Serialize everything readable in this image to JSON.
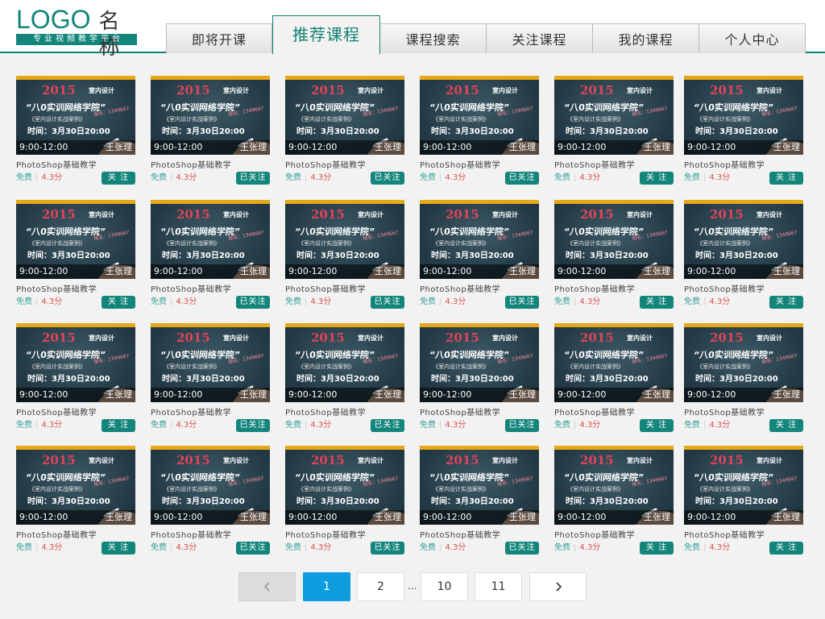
{
  "header": {
    "logo_text": "LOGO",
    "logo_name": "名称",
    "logo_sub": "专业视频教学平台",
    "brand_color": "#13857a"
  },
  "nav": {
    "tabs": [
      {
        "label": "即将开课",
        "active": false
      },
      {
        "label": "推荐课程",
        "active": true
      },
      {
        "label": "课程搜索",
        "active": false
      },
      {
        "label": "关注课程",
        "active": false
      },
      {
        "label": "我的课程",
        "active": false
      },
      {
        "label": "个人中心",
        "active": false
      }
    ]
  },
  "thumbnail_text": {
    "year": "2015",
    "tag": "室内设计",
    "line1": "“八0实训网络学院”",
    "line2": "《室内设计实战案例》",
    "line3": "时间：3月30日20:00",
    "line4": "报名：1349667"
  },
  "courses": {
    "rows": [
      [
        {
          "time": "9:00-12:00",
          "teacher": "王张理",
          "title": "PhotoShop基础教学",
          "price": "免费",
          "score": "4.3分",
          "follow": "关 注"
        },
        {
          "time": "9:00-12:00",
          "teacher": "王张理",
          "title": "PhotoShop基础教学",
          "price": "免费",
          "score": "4.3分",
          "follow": "已关注"
        },
        {
          "time": "9:00-12:00",
          "teacher": "王张理",
          "title": "PhotoShop基础教学",
          "price": "免费",
          "score": "4.3分",
          "follow": "已关注"
        },
        {
          "time": "9:00-12:00",
          "teacher": "王张理",
          "title": "PhotoShop基础教学",
          "price": "免费",
          "score": "4.3分",
          "follow": "已关注"
        },
        {
          "time": "9:00-12:00",
          "teacher": "王张理",
          "title": "PhotoShop基础教学",
          "price": "免费",
          "score": "4.3分",
          "follow": "关 注"
        },
        {
          "time": "9:00-12:00",
          "teacher": "王张理",
          "title": "PhotoShop基础教学",
          "price": "免费",
          "score": "4.3分",
          "follow": "关 注"
        }
      ],
      [
        {
          "time": "9:00-12:00",
          "teacher": "王张理",
          "title": "PhotoShop基础教学",
          "price": "免费",
          "score": "4.3分",
          "follow": "关 注"
        },
        {
          "time": "9:00-12:00",
          "teacher": "王张理",
          "title": "PhotoShop基础教学",
          "price": "免费",
          "score": "4.3分",
          "follow": "已关注"
        },
        {
          "time": "9:00-12:00",
          "teacher": "王张理",
          "title": "PhotoShop基础教学",
          "price": "免费",
          "score": "4.3分",
          "follow": "已关注"
        },
        {
          "time": "9:00-12:00",
          "teacher": "王张理",
          "title": "PhotoShop基础教学",
          "price": "免费",
          "score": "4.3分",
          "follow": "已关注"
        },
        {
          "time": "9:00-12:00",
          "teacher": "王张理",
          "title": "PhotoShop基础教学",
          "price": "免费",
          "score": "4.3分",
          "follow": "关 注"
        },
        {
          "time": "9:00-12:00",
          "teacher": "王张理",
          "title": "PhotoShop基础教学",
          "price": "免费",
          "score": "4.3分",
          "follow": "关 注"
        }
      ],
      [
        {
          "time": "9:00-12:00",
          "teacher": "王张理",
          "title": "PhotoShop基础教学",
          "price": "免费",
          "score": "4.3分",
          "follow": "关 注"
        },
        {
          "time": "9:00-12:00",
          "teacher": "王张理",
          "title": "PhotoShop基础教学",
          "price": "免费",
          "score": "4.3分",
          "follow": "已关注"
        },
        {
          "time": "9:00-12:00",
          "teacher": "王张理",
          "title": "PhotoShop基础教学",
          "price": "免费",
          "score": "4.3分",
          "follow": "已关注"
        },
        {
          "time": "9:00-12:00",
          "teacher": "王张理",
          "title": "PhotoShop基础教学",
          "price": "免费",
          "score": "4.3分",
          "follow": "已关注"
        },
        {
          "time": "9:00-12:00",
          "teacher": "王张理",
          "title": "PhotoShop基础教学",
          "price": "免费",
          "score": "4.3分",
          "follow": "关 注"
        },
        {
          "time": "9:00-12:00",
          "teacher": "王张理",
          "title": "PhotoShop基础教学",
          "price": "免费",
          "score": "4.3分",
          "follow": "关 注"
        }
      ],
      [
        {
          "time": "9:00-12:00",
          "teacher": "王张理",
          "title": "PhotoShop基础教学",
          "price": "免费",
          "score": "4.3分",
          "follow": "关 注"
        },
        {
          "time": "9:00-12:00",
          "teacher": "王张理",
          "title": "PhotoShop基础教学",
          "price": "免费",
          "score": "4.3分",
          "follow": "已关注"
        },
        {
          "time": "9:00-12:00",
          "teacher": "王张理",
          "title": "PhotoShop基础教学",
          "price": "免费",
          "score": "4.3分",
          "follow": "已关注"
        },
        {
          "time": "9:00-12:00",
          "teacher": "王张理",
          "title": "PhotoShop基础教学",
          "price": "免费",
          "score": "4.3分",
          "follow": "已关注"
        },
        {
          "time": "9:00-12:00",
          "teacher": "王张理",
          "title": "PhotoShop基础教学",
          "price": "免费",
          "score": "4.3分",
          "follow": "关 注"
        },
        {
          "time": "9:00-12:00",
          "teacher": "王张理",
          "title": "PhotoShop基础教学",
          "price": "免费",
          "score": "4.3分",
          "follow": "关 注"
        }
      ]
    ]
  },
  "pagination": {
    "prev_icon": "chevron-left-icon",
    "next_icon": "chevron-right-icon",
    "pages": [
      "1",
      "2",
      "10",
      "11"
    ],
    "ellipsis": "...",
    "current": "1",
    "active_color": "#0e9ee0"
  }
}
